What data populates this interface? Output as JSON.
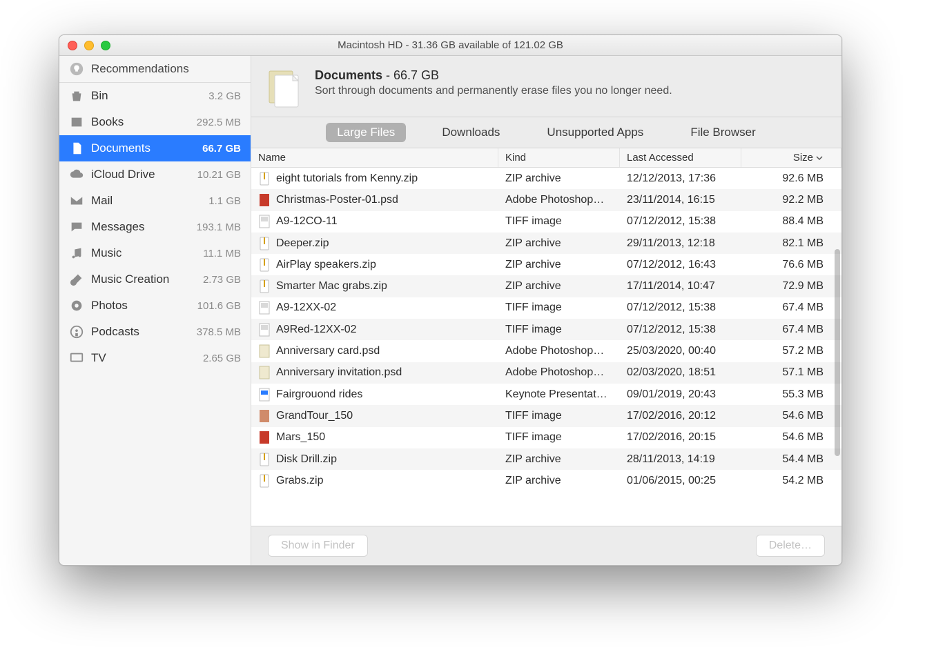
{
  "window_title": "Macintosh HD - 31.36 GB available of 121.02 GB",
  "sidebar": {
    "group_title": "Recommendations",
    "items": [
      {
        "label": "Bin",
        "size": "3.2 GB",
        "icon": "trash-icon"
      },
      {
        "label": "Books",
        "size": "292.5 MB",
        "icon": "book-icon"
      },
      {
        "label": "Documents",
        "size": "66.7 GB",
        "icon": "document-icon",
        "selected": true
      },
      {
        "label": "iCloud Drive",
        "size": "10.21 GB",
        "icon": "cloud-icon"
      },
      {
        "label": "Mail",
        "size": "1.1 GB",
        "icon": "mail-icon"
      },
      {
        "label": "Messages",
        "size": "193.1 MB",
        "icon": "messages-icon"
      },
      {
        "label": "Music",
        "size": "11.1 MB",
        "icon": "music-icon"
      },
      {
        "label": "Music Creation",
        "size": "2.73 GB",
        "icon": "guitar-icon"
      },
      {
        "label": "Photos",
        "size": "101.6 GB",
        "icon": "photos-icon"
      },
      {
        "label": "Podcasts",
        "size": "378.5 MB",
        "icon": "podcasts-icon"
      },
      {
        "label": "TV",
        "size": "2.65 GB",
        "icon": "tv-icon"
      }
    ]
  },
  "header": {
    "title_bold": "Documents",
    "title_rest": " - 66.7 GB",
    "subtitle": "Sort through documents and permanently erase files you no longer need."
  },
  "tabs": [
    {
      "label": "Large Files",
      "active": true
    },
    {
      "label": "Downloads"
    },
    {
      "label": "Unsupported Apps"
    },
    {
      "label": "File Browser"
    }
  ],
  "columns": {
    "name": "Name",
    "kind": "Kind",
    "last_accessed": "Last Accessed",
    "size": "Size"
  },
  "files": [
    {
      "name": "eight tutorials from Kenny.zip",
      "kind": "ZIP archive",
      "la": "12/12/2013, 17:36",
      "size": "92.6 MB",
      "ficon": "zip"
    },
    {
      "name": "Christmas-Poster-01.psd",
      "kind": "Adobe Photoshop…",
      "la": "23/11/2014, 16:15",
      "size": "92.2 MB",
      "ficon": "psd"
    },
    {
      "name": "A9-12CO-11",
      "kind": "TIFF image",
      "la": "07/12/2012, 15:38",
      "size": "88.4 MB",
      "ficon": "tiff"
    },
    {
      "name": "Deeper.zip",
      "kind": "ZIP archive",
      "la": "29/11/2013, 12:18",
      "size": "82.1 MB",
      "ficon": "zip"
    },
    {
      "name": "AirPlay speakers.zip",
      "kind": "ZIP archive",
      "la": "07/12/2012, 16:43",
      "size": "76.6 MB",
      "ficon": "zip"
    },
    {
      "name": "Smarter Mac grabs.zip",
      "kind": "ZIP archive",
      "la": "17/11/2014, 10:47",
      "size": "72.9 MB",
      "ficon": "zip"
    },
    {
      "name": "A9-12XX-02",
      "kind": "TIFF image",
      "la": "07/12/2012, 15:38",
      "size": "67.4 MB",
      "ficon": "tiff"
    },
    {
      "name": "A9Red-12XX-02",
      "kind": "TIFF image",
      "la": "07/12/2012, 15:38",
      "size": "67.4 MB",
      "ficon": "tiff"
    },
    {
      "name": "Anniversary card.psd",
      "kind": "Adobe Photoshop…",
      "la": "25/03/2020, 00:40",
      "size": "57.2 MB",
      "ficon": "psd2"
    },
    {
      "name": "Anniversary invitation.psd",
      "kind": "Adobe Photoshop…",
      "la": "02/03/2020, 18:51",
      "size": "57.1 MB",
      "ficon": "psd2"
    },
    {
      "name": "Fairgrouond rides",
      "kind": "Keynote Presentat…",
      "la": "09/01/2019, 20:43",
      "size": "55.3 MB",
      "ficon": "key"
    },
    {
      "name": "GrandTour_150",
      "kind": "TIFF image",
      "la": "17/02/2016, 20:12",
      "size": "54.6 MB",
      "ficon": "tiff2"
    },
    {
      "name": "Mars_150",
      "kind": "TIFF image",
      "la": "17/02/2016, 20:15",
      "size": "54.6 MB",
      "ficon": "tiff3"
    },
    {
      "name": "Disk Drill.zip",
      "kind": "ZIP archive",
      "la": "28/11/2013, 14:19",
      "size": "54.4 MB",
      "ficon": "zip"
    },
    {
      "name": "Grabs.zip",
      "kind": "ZIP archive",
      "la": "01/06/2015, 00:25",
      "size": "54.2 MB",
      "ficon": "zip"
    }
  ],
  "footer": {
    "show_in_finder": "Show in Finder",
    "delete": "Delete…"
  }
}
